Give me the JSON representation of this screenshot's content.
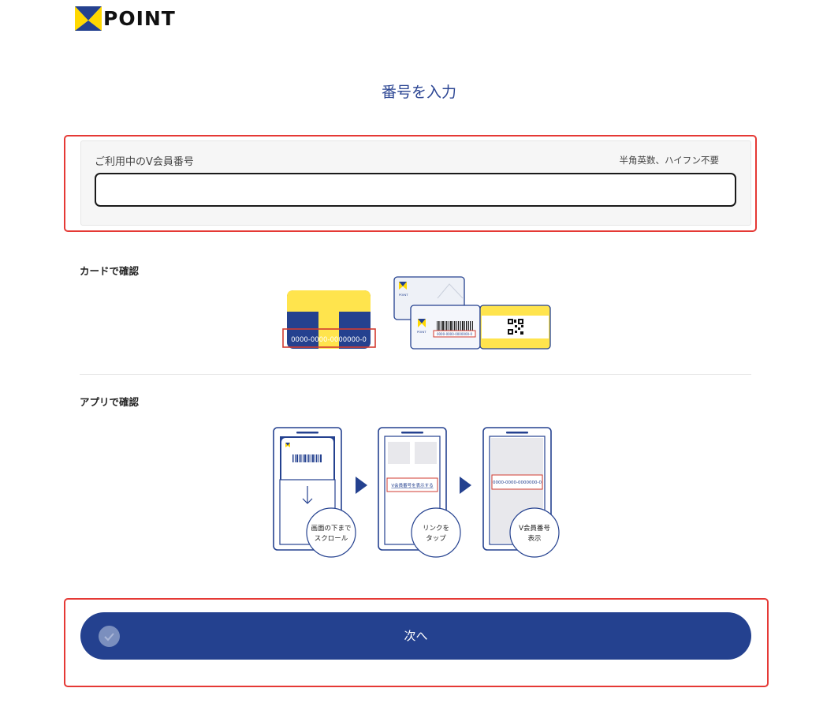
{
  "header": {
    "logo_text": "POINT"
  },
  "page": {
    "title": "番号を入力"
  },
  "member_field": {
    "label": "ご利用中のV会員番号",
    "hint": "半角英数、ハイフン不要",
    "value": ""
  },
  "card_section": {
    "title": "カードで確認",
    "card_number": "0000-0000-0000000-0",
    "mini_card_number": "0000-0000-0000000-0",
    "mini_logo_text": "POINT"
  },
  "app_section": {
    "title": "アプリで確認",
    "link_text": "V会員番号を表示する",
    "shown_number": "0000-0000-0000000-0",
    "steps": [
      {
        "line1": "画面の下まで",
        "line2": "スクロール"
      },
      {
        "line1": "リンクを",
        "line2": "タップ"
      },
      {
        "line1": "V会員番号",
        "line2": "表示"
      }
    ]
  },
  "actions": {
    "next_label": "次へ"
  },
  "colors": {
    "brand_blue": "#24418f",
    "brand_yellow": "#ffe44d",
    "highlight_red": "#e53935"
  }
}
